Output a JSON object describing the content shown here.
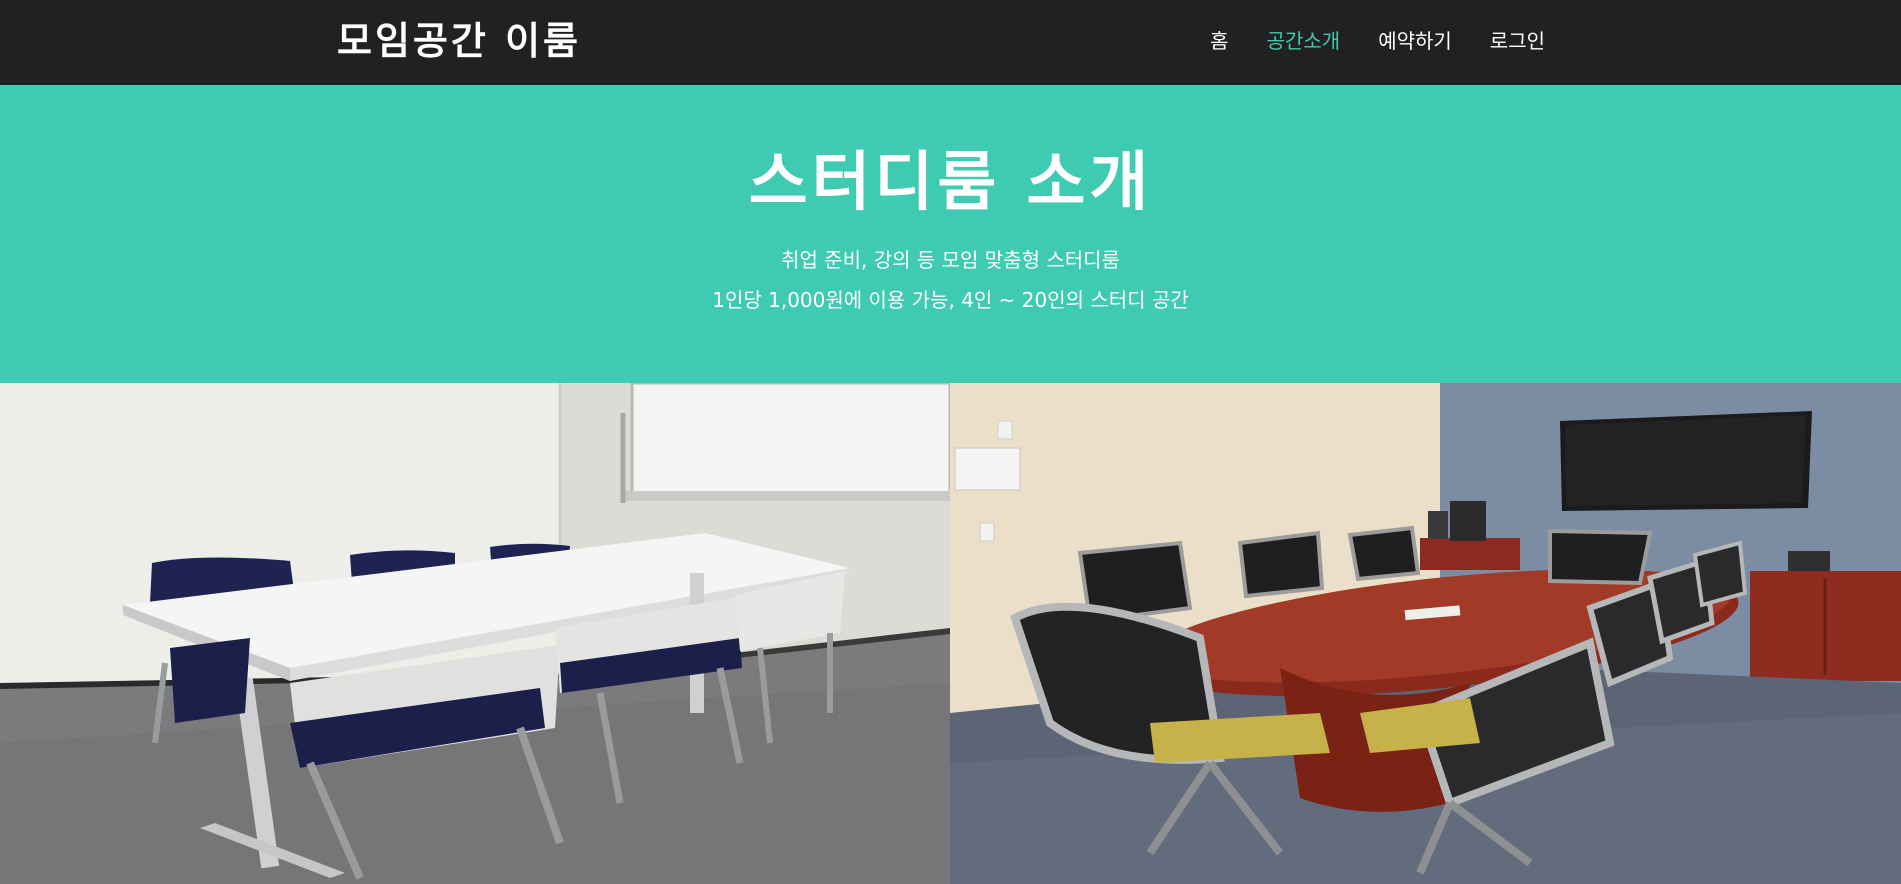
{
  "nav": {
    "brand": "모임공간 이룸",
    "links": [
      {
        "label": "홈",
        "active": false
      },
      {
        "label": "공간소개",
        "active": true
      },
      {
        "label": "예약하기",
        "active": false
      },
      {
        "label": "로그인",
        "active": false
      }
    ]
  },
  "hero": {
    "title": "스터디룸 소개",
    "line1": "취업 준비, 강의 등 모임 맞춤형 스터디룸",
    "line2": "1인당 1,000원에 이용 가능, 4인 ~ 20인의 스터디 공간"
  },
  "colors": {
    "navbar": "#212121",
    "accent": "#3ecbb2",
    "text": "#ffffff"
  },
  "gallery": {
    "images": [
      {
        "name": "small-study-room-photo"
      },
      {
        "name": "conference-room-photo"
      }
    ]
  }
}
